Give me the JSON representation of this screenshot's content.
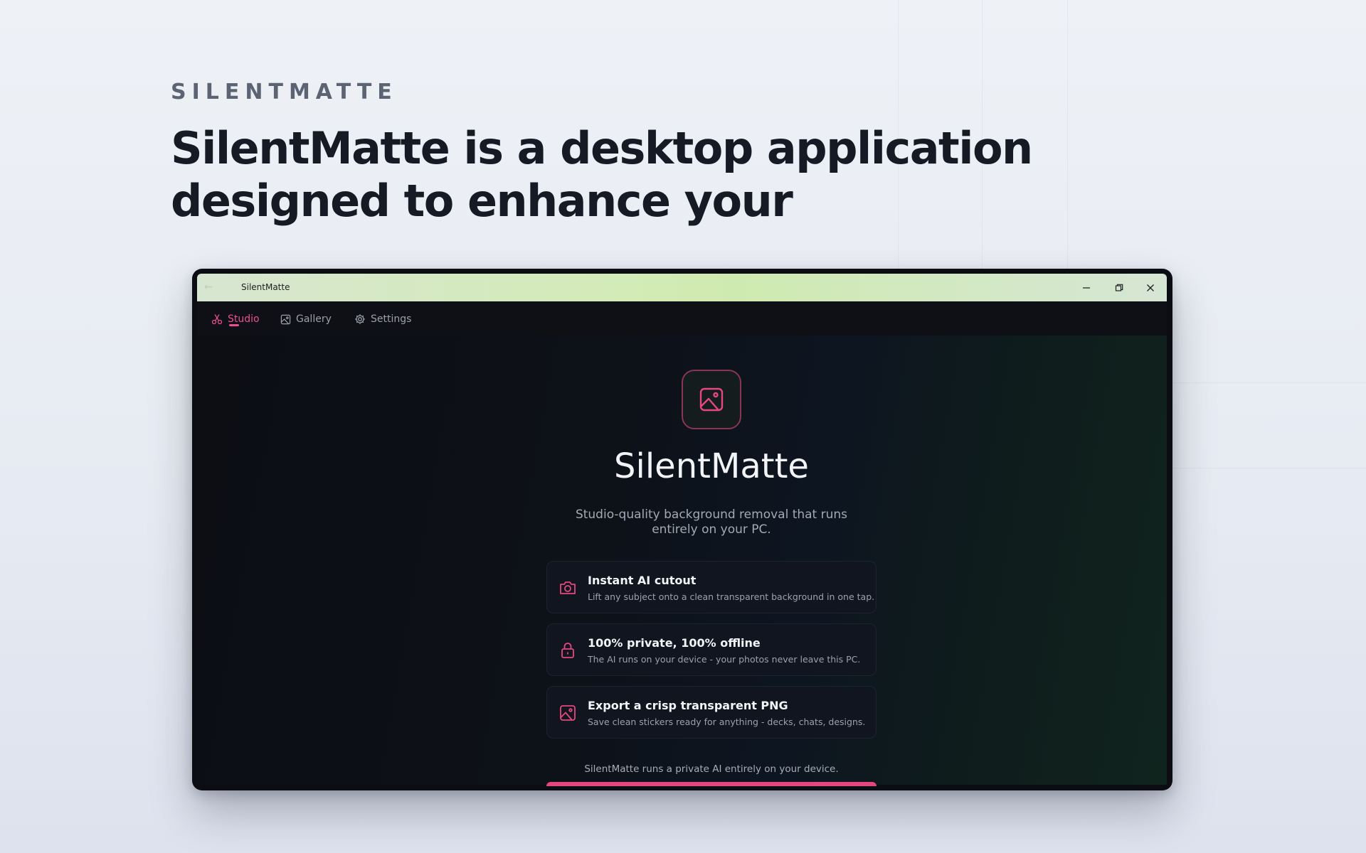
{
  "page": {
    "eyebrow": "SILENTMATTE",
    "headline": "SilentMatte is a desktop application designed to enhance your"
  },
  "window": {
    "title": "SilentMatte",
    "controls": {
      "minimize_icon": "minimize-icon",
      "restore_icon": "restore-icon",
      "close_icon": "close-icon"
    }
  },
  "nav": {
    "items": [
      {
        "label": "Studio",
        "icon": "scissors-icon",
        "active": true
      },
      {
        "label": "Gallery",
        "icon": "image-icon",
        "active": false
      },
      {
        "label": "Settings",
        "icon": "gear-icon",
        "active": false
      }
    ]
  },
  "hero": {
    "app_name": "SilentMatte",
    "tagline": "Studio-quality background removal that runs entirely on your PC.",
    "logo_icon": "image-icon"
  },
  "features": [
    {
      "icon": "camera-icon",
      "title": "Instant AI cutout",
      "desc": "Lift any subject onto a clean transparent background in one tap."
    },
    {
      "icon": "lock-icon",
      "title": "100% private, 100% offline",
      "desc": "The AI runs on your device - your photos never leave this PC."
    },
    {
      "icon": "image-icon",
      "title": "Export a crisp transparent PNG",
      "desc": "Save clean stickers ready for anything - decks, chats, designs."
    }
  ],
  "footer": {
    "note": "SilentMatte runs a private AI entirely on your device."
  },
  "colors": {
    "accent": "#ec4f8d",
    "titlebar": "#d3ebb6",
    "background": "#0c0e14"
  }
}
